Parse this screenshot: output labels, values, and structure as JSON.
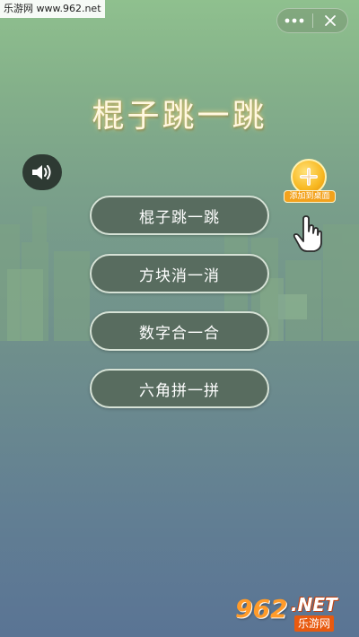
{
  "watermark": {
    "top_text": "乐游网 www.962.net",
    "bottom_num": "962",
    "bottom_net": ".NET",
    "bottom_cn": "乐游网"
  },
  "capsule": {
    "more_icon": "more-dots-icon",
    "close_icon": "close-icon"
  },
  "game": {
    "title": "棍子跳一跳",
    "sound_icon": "speaker-icon",
    "add_to_desktop_label": "添加到桌面",
    "hand_icon": "pointer-hand-icon"
  },
  "menu": {
    "items": [
      {
        "label": "棍子跳一跳"
      },
      {
        "label": "方块消一消"
      },
      {
        "label": "数字合一合"
      },
      {
        "label": "六角拼一拼"
      }
    ]
  },
  "colors": {
    "button_fill": "#586c5f",
    "button_border": "#d6e2d6",
    "accent": "#f8b820"
  }
}
